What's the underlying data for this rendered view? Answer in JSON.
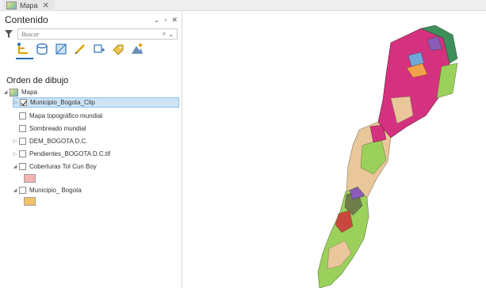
{
  "tab": {
    "label": "Mapa"
  },
  "pane": {
    "title": "Contenido",
    "search_placeholder": "Buscar",
    "section_title": "Orden de dibujo"
  },
  "tree": {
    "root": "Mapa",
    "layers": [
      {
        "label": "Municipio_Bogota_Clip",
        "checked": true,
        "selected": true
      },
      {
        "label": "Mapa topográfico mundial",
        "checked": false
      },
      {
        "label": "Sombreado mundial",
        "checked": false
      },
      {
        "label": "DEM_BOGOTA D.C.",
        "checked": false
      },
      {
        "label": "Pendientes_BOGOTA D.C.tif",
        "checked": false
      },
      {
        "label": "Coberturas Tol Cun Boy",
        "checked": false,
        "swatch_color": "#f3b3b3"
      },
      {
        "label": "Municipio_ Bogota",
        "checked": false,
        "swatch_color": "#f0c26a"
      }
    ]
  },
  "colors": {
    "accent": "#2b6cb0",
    "selection": "#cde4f7",
    "map_magenta": "#d4327f",
    "map_green": "#9bd15a",
    "map_tan": "#e9c79a"
  }
}
